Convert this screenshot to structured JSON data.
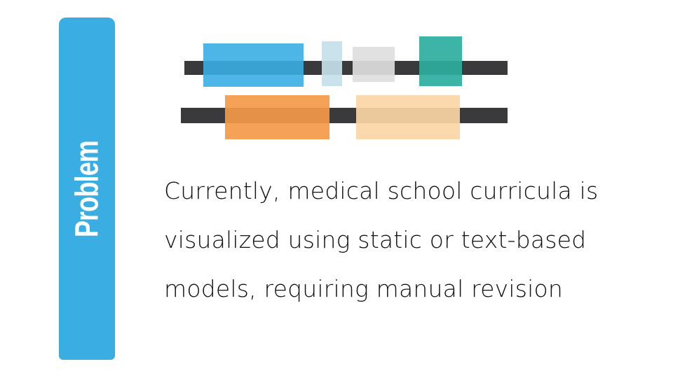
{
  "slide": {
    "sidebar": {
      "label": "Problem",
      "color": "#3aaee3"
    },
    "body_lines": [
      "Currently, medical school curricula is",
      "visualized using static or text-based",
      "models, requiring manual revision"
    ],
    "illustration": {
      "track_color": "#3a3a3c",
      "top_row_colors": [
        "#3aaee3",
        "#c5dfea",
        "#dedede",
        "#2cae9e"
      ],
      "bottom_row_colors": [
        "#f5994a",
        "#fcd5a6"
      ]
    }
  }
}
